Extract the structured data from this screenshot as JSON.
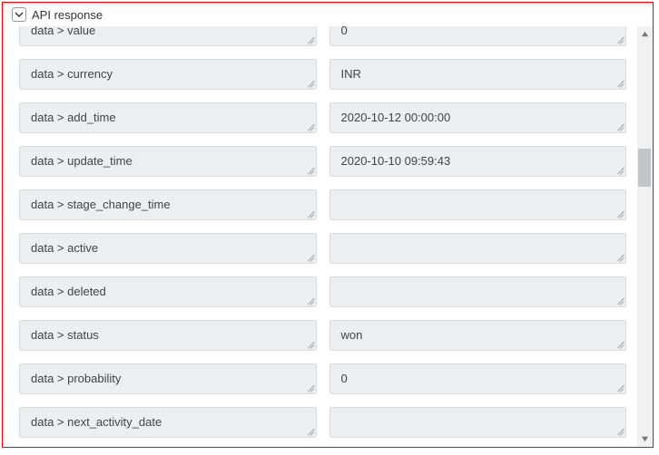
{
  "panel": {
    "title": "API response"
  },
  "rows": [
    {
      "key": "data > value",
      "value": "0"
    },
    {
      "key": "data > currency",
      "value": "INR"
    },
    {
      "key": "data > add_time",
      "value": "2020-10-12 00:00:00"
    },
    {
      "key": "data > update_time",
      "value": "2020-10-10 09:59:43"
    },
    {
      "key": "data > stage_change_time",
      "value": ""
    },
    {
      "key": "data > active",
      "value": ""
    },
    {
      "key": "data > deleted",
      "value": ""
    },
    {
      "key": "data > status",
      "value": "won"
    },
    {
      "key": "data > probability",
      "value": "0"
    },
    {
      "key": "data > next_activity_date",
      "value": ""
    }
  ]
}
